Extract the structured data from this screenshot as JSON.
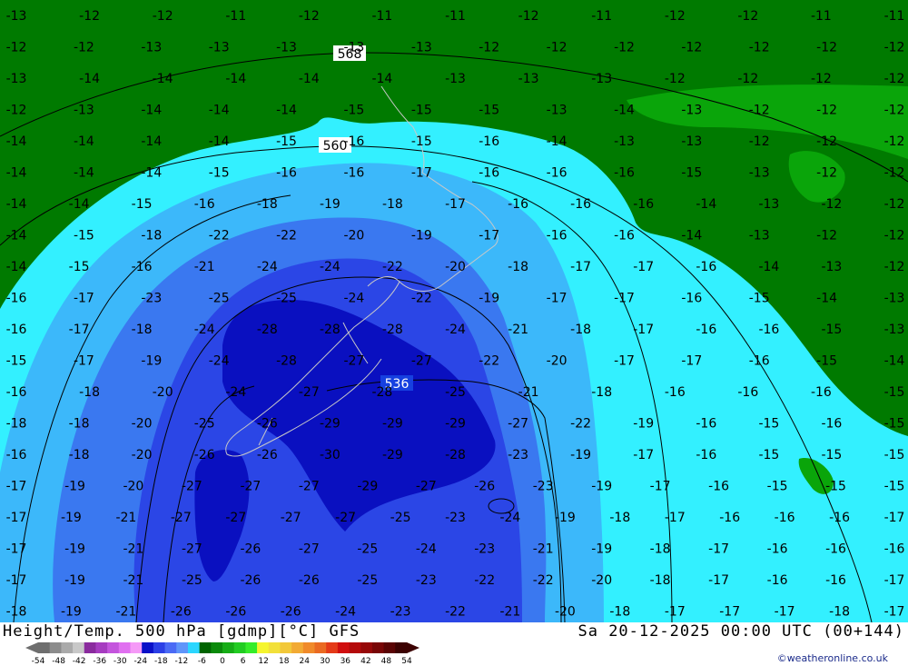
{
  "map": {
    "contour_labels": [
      "568",
      "560",
      "536"
    ],
    "temp_labels": [
      "-13",
      "-12",
      "-12",
      "-11",
      "-12",
      "-11",
      "-11",
      "-12",
      "-11",
      "-12",
      "-12",
      "-11",
      "-11",
      "-12",
      "-12",
      "-13",
      "-13",
      "-13",
      "-13",
      "-13",
      "-12",
      "-12",
      "-12",
      "-12",
      "-12",
      "-12",
      "-12",
      "-13",
      "-14",
      "-14",
      "-14",
      "-14",
      "-14",
      "-13",
      "-13",
      "-13",
      "-12",
      "-12",
      "-12",
      "-12",
      "-12",
      "-13",
      "-14",
      "-14",
      "-14",
      "-15",
      "-15",
      "-15",
      "-13",
      "-14",
      "-13",
      "-12",
      "-12",
      "-12",
      "-14",
      "-14",
      "-14",
      "-14",
      "-15",
      "-16",
      "-15",
      "-16",
      "-14",
      "-13",
      "-13",
      "-12",
      "-12",
      "-12",
      "-14",
      "-14",
      "-14",
      "-15",
      "-16",
      "-16",
      "-17",
      "-16",
      "-16",
      "-16",
      "-15",
      "-13",
      "-12",
      "-12",
      "-14",
      "-14",
      "-15",
      "-16",
      "-18",
      "-19",
      "-18",
      "-17",
      "-16",
      "-16",
      "-16",
      "-14",
      "-13",
      "-12",
      "-12",
      "-14",
      "-15",
      "-18",
      "-22",
      "-22",
      "-20",
      "-19",
      "-17",
      "-16",
      "-16",
      "-14",
      "-13",
      "-12",
      "-12",
      "-14",
      "-15",
      "-16",
      "-21",
      "-24",
      "-24",
      "-22",
      "-20",
      "-18",
      "-17",
      "-17",
      "-16",
      "-14",
      "-13",
      "-12",
      "-16",
      "-17",
      "-23",
      "-25",
      "-25",
      "-24",
      "-22",
      "-19",
      "-17",
      "-17",
      "-16",
      "-15",
      "-14",
      "-13",
      "-16",
      "-17",
      "-18",
      "-24",
      "-28",
      "-28",
      "-28",
      "-24",
      "-21",
      "-18",
      "-17",
      "-16",
      "-16",
      "-15",
      "-13",
      "-15",
      "-17",
      "-19",
      "-24",
      "-28",
      "-27",
      "-27",
      "-22",
      "-20",
      "-17",
      "-17",
      "-16",
      "-15",
      "-14",
      "-16",
      "-18",
      "-20",
      "-24",
      "-27",
      "-28",
      "-25",
      "-21",
      "-18",
      "-16",
      "-16",
      "-16",
      "-15",
      "-18",
      "-18",
      "-20",
      "-25",
      "-26",
      "-29",
      "-29",
      "-29",
      "-27",
      "-22",
      "-19",
      "-16",
      "-15",
      "-16",
      "-15",
      "-16",
      "-18",
      "-20",
      "-26",
      "-26",
      "-30",
      "-29",
      "-28",
      "-23",
      "-19",
      "-17",
      "-16",
      "-15",
      "-15",
      "-15",
      "-17",
      "-19",
      "-20",
      "-27",
      "-27",
      "-27",
      "-29",
      "-27",
      "-26",
      "-23",
      "-19",
      "-17",
      "-16",
      "-15",
      "-15",
      "-15",
      "-17",
      "-19",
      "-21",
      "-27",
      "-27",
      "-27",
      "-27",
      "-25",
      "-23",
      "-24",
      "-19",
      "-18",
      "-17",
      "-16",
      "-16",
      "-16",
      "-17",
      "-17",
      "-19",
      "-21",
      "-27",
      "-26",
      "-27",
      "-25",
      "-24",
      "-23",
      "-21",
      "-19",
      "-18",
      "-17",
      "-16",
      "-16",
      "-16",
      "-17",
      "-19",
      "-21",
      "-25",
      "-26",
      "-26",
      "-25",
      "-23",
      "-22",
      "-22",
      "-20",
      "-18",
      "-17",
      "-16",
      "-16",
      "-17",
      "-18",
      "-19",
      "-21",
      "-26",
      "-26",
      "-26",
      "-24",
      "-23",
      "-22",
      "-21",
      "-20",
      "-18",
      "-17",
      "-17",
      "-17",
      "-18",
      "-17"
    ]
  },
  "footer": {
    "title": "Height/Temp. 500 hPa [gdmp][°C] GFS",
    "datetime": "Sa 20-12-2025 00:00 UTC (00+144)",
    "credit": "©weatheronline.co.uk",
    "legend_ticks": [
      "-54",
      "-48",
      "-42",
      "-36",
      "-30",
      "-24",
      "-18",
      "-12",
      "-6",
      "0",
      "6",
      "12",
      "18",
      "24",
      "30",
      "36",
      "42",
      "48",
      "54"
    ],
    "legend_colors": [
      "#6e6e6e",
      "#8c8c8c",
      "#aaaaaa",
      "#c8c8c8",
      "#8a2b9e",
      "#a63cc0",
      "#c455dd",
      "#e070f0",
      "#f59af7",
      "#0a10c8",
      "#2b3fe6",
      "#4a6af5",
      "#5f95fa",
      "#2bd6ff",
      "#006400",
      "#0b8a0b",
      "#16ad16",
      "#22cc22",
      "#36ec2a",
      "#f5f52e",
      "#f2e03a",
      "#f2c83a",
      "#f2aa34",
      "#f08a2a",
      "#ea6a22",
      "#e43a18",
      "#d00e0e",
      "#b40a0a",
      "#960808",
      "#780606",
      "#5a0404",
      "#3c0202"
    ]
  }
}
